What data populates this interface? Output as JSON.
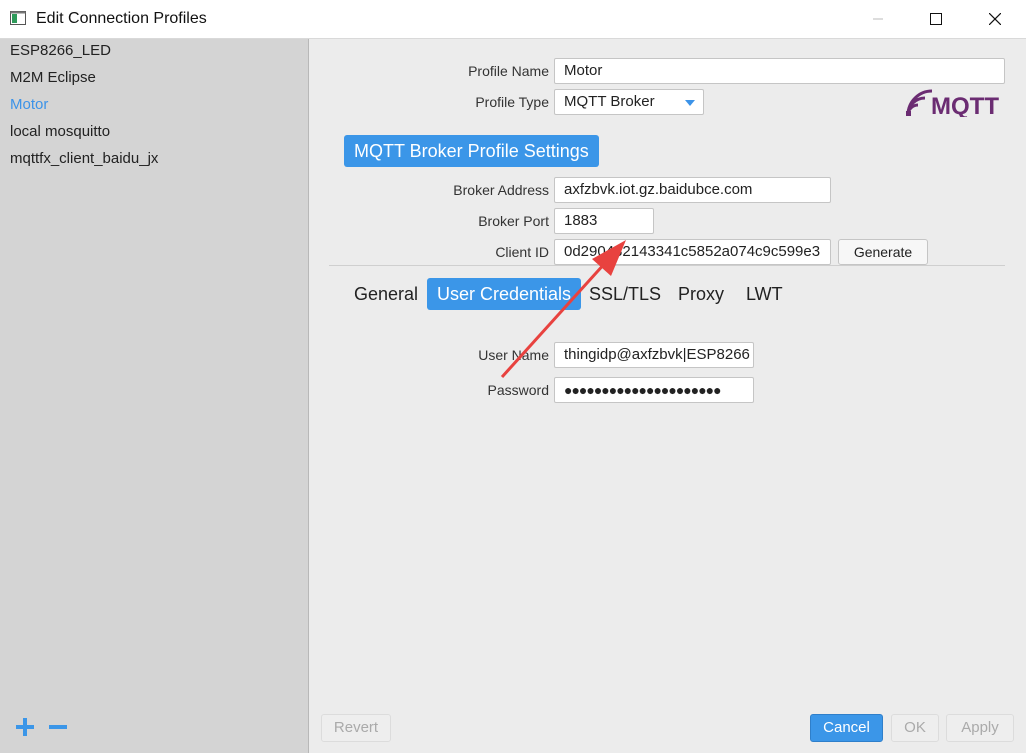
{
  "window": {
    "title": "Edit Connection Profiles"
  },
  "sidebar": {
    "profiles": [
      "ESP8266_LED",
      "M2M Eclipse",
      "Motor",
      "local mosquitto",
      "mqttfx_client_baidu_jx"
    ],
    "selected": "Motor",
    "add_icon": "plus-icon",
    "remove_icon": "minus-icon"
  },
  "profile": {
    "name_label": "Profile Name",
    "name_value": "Motor",
    "type_label": "Profile Type",
    "type_value": "MQTT Broker",
    "logo_text": "MQTT"
  },
  "broker": {
    "section_title": "MQTT Broker Profile Settings",
    "address_label": "Broker Address",
    "address_value": "axfzbvk.iot.gz.baidubce.com",
    "port_label": "Broker Port",
    "port_value": "1883",
    "client_id_label": "Client ID",
    "client_id_value": "0d290482143341c5852a074c9c599e3",
    "generate_label": "Generate"
  },
  "tabs": [
    "General",
    "User Credentials",
    "SSL/TLS",
    "Proxy",
    "LWT"
  ],
  "active_tab": "User Credentials",
  "credentials": {
    "username_label": "User Name",
    "username_value": "thingidp@axfzbvk|ESP8266",
    "password_label": "Password",
    "password_value": "●●●●●●●●●●●●●●●●●●●●●"
  },
  "footer": {
    "revert": "Revert",
    "cancel": "Cancel",
    "ok": "OK",
    "apply": "Apply"
  },
  "colors": {
    "accent": "#3b96e8",
    "sidebar_bg": "#d4d4d4",
    "panel_bg": "#ececec",
    "annotation_arrow": "#e8423f",
    "mqtt_logo": "#6b2c72"
  }
}
